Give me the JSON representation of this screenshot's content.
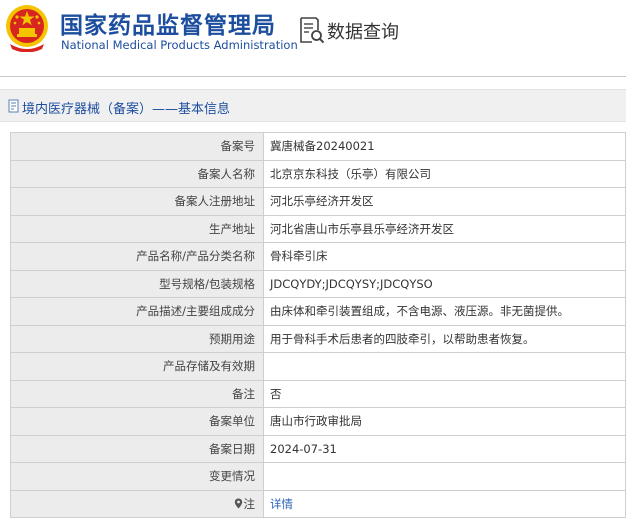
{
  "header": {
    "agency_cn": "国家药品监督管理局",
    "agency_en": "National Medical Products Administration",
    "db_title": "数据查询"
  },
  "section": {
    "title": "境内医疗器械（备案）——基本信息"
  },
  "colors": {
    "brand_blue": "#1d4e9e",
    "emblem_red": "#d7261f",
    "emblem_gold": "#f5c400",
    "label_bg": "#ececec",
    "link_blue": "#2a62b8"
  },
  "rows": [
    {
      "label": "备案号",
      "value": "冀唐械备20240021"
    },
    {
      "label": "备案人名称",
      "value": "北京京东科技（乐亭）有限公司"
    },
    {
      "label": "备案人注册地址",
      "value": "河北乐亭经济开发区"
    },
    {
      "label": "生产地址",
      "value": "河北省唐山市乐亭县乐亭经济开发区"
    },
    {
      "label": "产品名称/产品分类名称",
      "value": "骨科牵引床"
    },
    {
      "label": "型号规格/包装规格",
      "value": "JDCQYDY;JDCQYSY;JDCQYSO"
    },
    {
      "label": "产品描述/主要组成成分",
      "value": "由床体和牵引装置组成，不含电源、液压源。非无菌提供。"
    },
    {
      "label": "预期用途",
      "value": "用于骨科手术后患者的四肢牵引，以帮助患者恢复。"
    },
    {
      "label": "产品存储及有效期",
      "value": ""
    },
    {
      "label": "备注",
      "value": "否"
    },
    {
      "label": "备案单位",
      "value": "唐山市行政审批局"
    },
    {
      "label": "备案日期",
      "value": "2024-07-31"
    },
    {
      "label": "变更情况",
      "value": ""
    },
    {
      "label": "注",
      "value": "详情",
      "icon": "location-pin-icon"
    }
  ]
}
